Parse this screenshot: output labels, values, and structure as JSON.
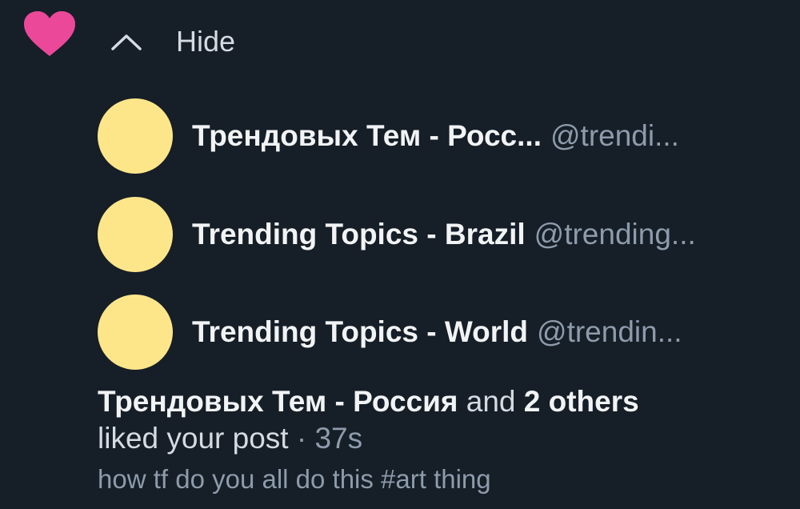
{
  "colors": {
    "background": "#161e27",
    "heart": "#ec4899",
    "avatar": "#fde68a",
    "text_primary": "#f1f3f5",
    "text_muted": "#8d9bab"
  },
  "notification": {
    "icon": "heart-icon",
    "toggle": {
      "icon": "chevron-up-icon",
      "label": "Hide"
    },
    "users": [
      {
        "name": "Трендовых Тем - Росс...",
        "handle": "@trendi..."
      },
      {
        "name": "Trending Topics - Brazil",
        "handle": "@trending..."
      },
      {
        "name": "Trending Topics - World",
        "handle": "@trendin..."
      }
    ],
    "summary": {
      "actor": "Трендовых Тем - Россия",
      "connector": "and",
      "others": "2 others",
      "action": "liked your post",
      "separator": "·",
      "time": "37s"
    },
    "post_text": "how tf do you all do this #art thing"
  }
}
